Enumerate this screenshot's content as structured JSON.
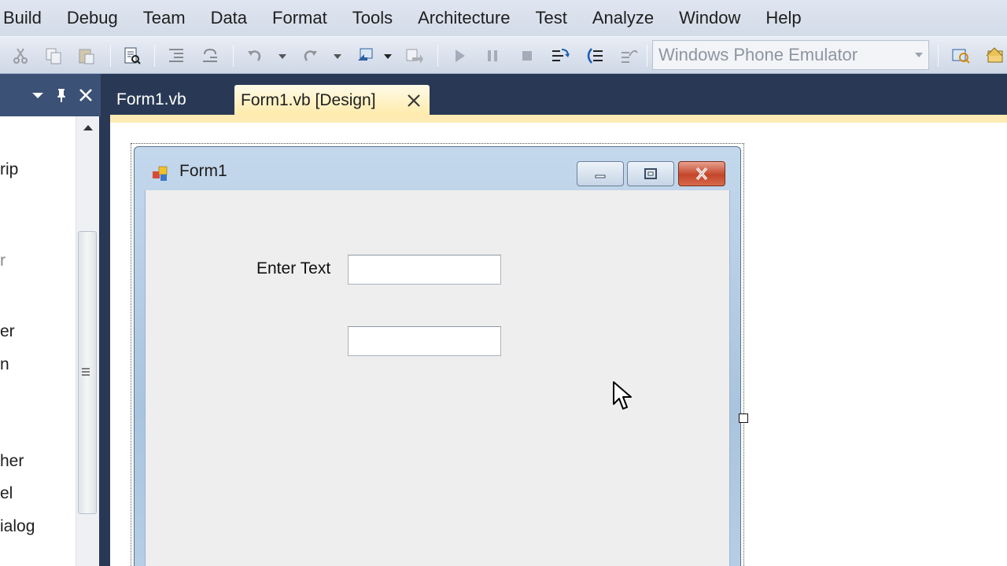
{
  "menu": {
    "items": [
      "Build",
      "Debug",
      "Team",
      "Data",
      "Format",
      "Tools",
      "Architecture",
      "Test",
      "Analyze",
      "Window",
      "Help"
    ]
  },
  "toolbar": {
    "device_select": "Windows Phone Emulator",
    "icons": [
      "cut-icon",
      "copy-icon",
      "paste-icon",
      "find-icon",
      "indent-icon",
      "outdent-icon",
      "undo-icon",
      "redo-icon",
      "navigate-icon",
      "publish-icon",
      "start-icon",
      "pause-icon",
      "stop-icon",
      "step-into-icon",
      "step-over-icon",
      "step-out-icon",
      "solution-explorer-icon",
      "properties-icon"
    ]
  },
  "toolbox": {
    "visible_items": [
      "rip",
      "r",
      "er",
      "n",
      "her",
      "el",
      "ialog"
    ]
  },
  "tabs": {
    "inactive": "Form1.vb",
    "active": "Form1.vb [Design]"
  },
  "form": {
    "title": "Form1",
    "label_text": "Enter Text",
    "textbox1_value": "",
    "textbox2_value": ""
  },
  "colors": {
    "accent_tab": "#ffeaa8",
    "chrome_dark": "#293955",
    "close_button": "#c4462a"
  }
}
